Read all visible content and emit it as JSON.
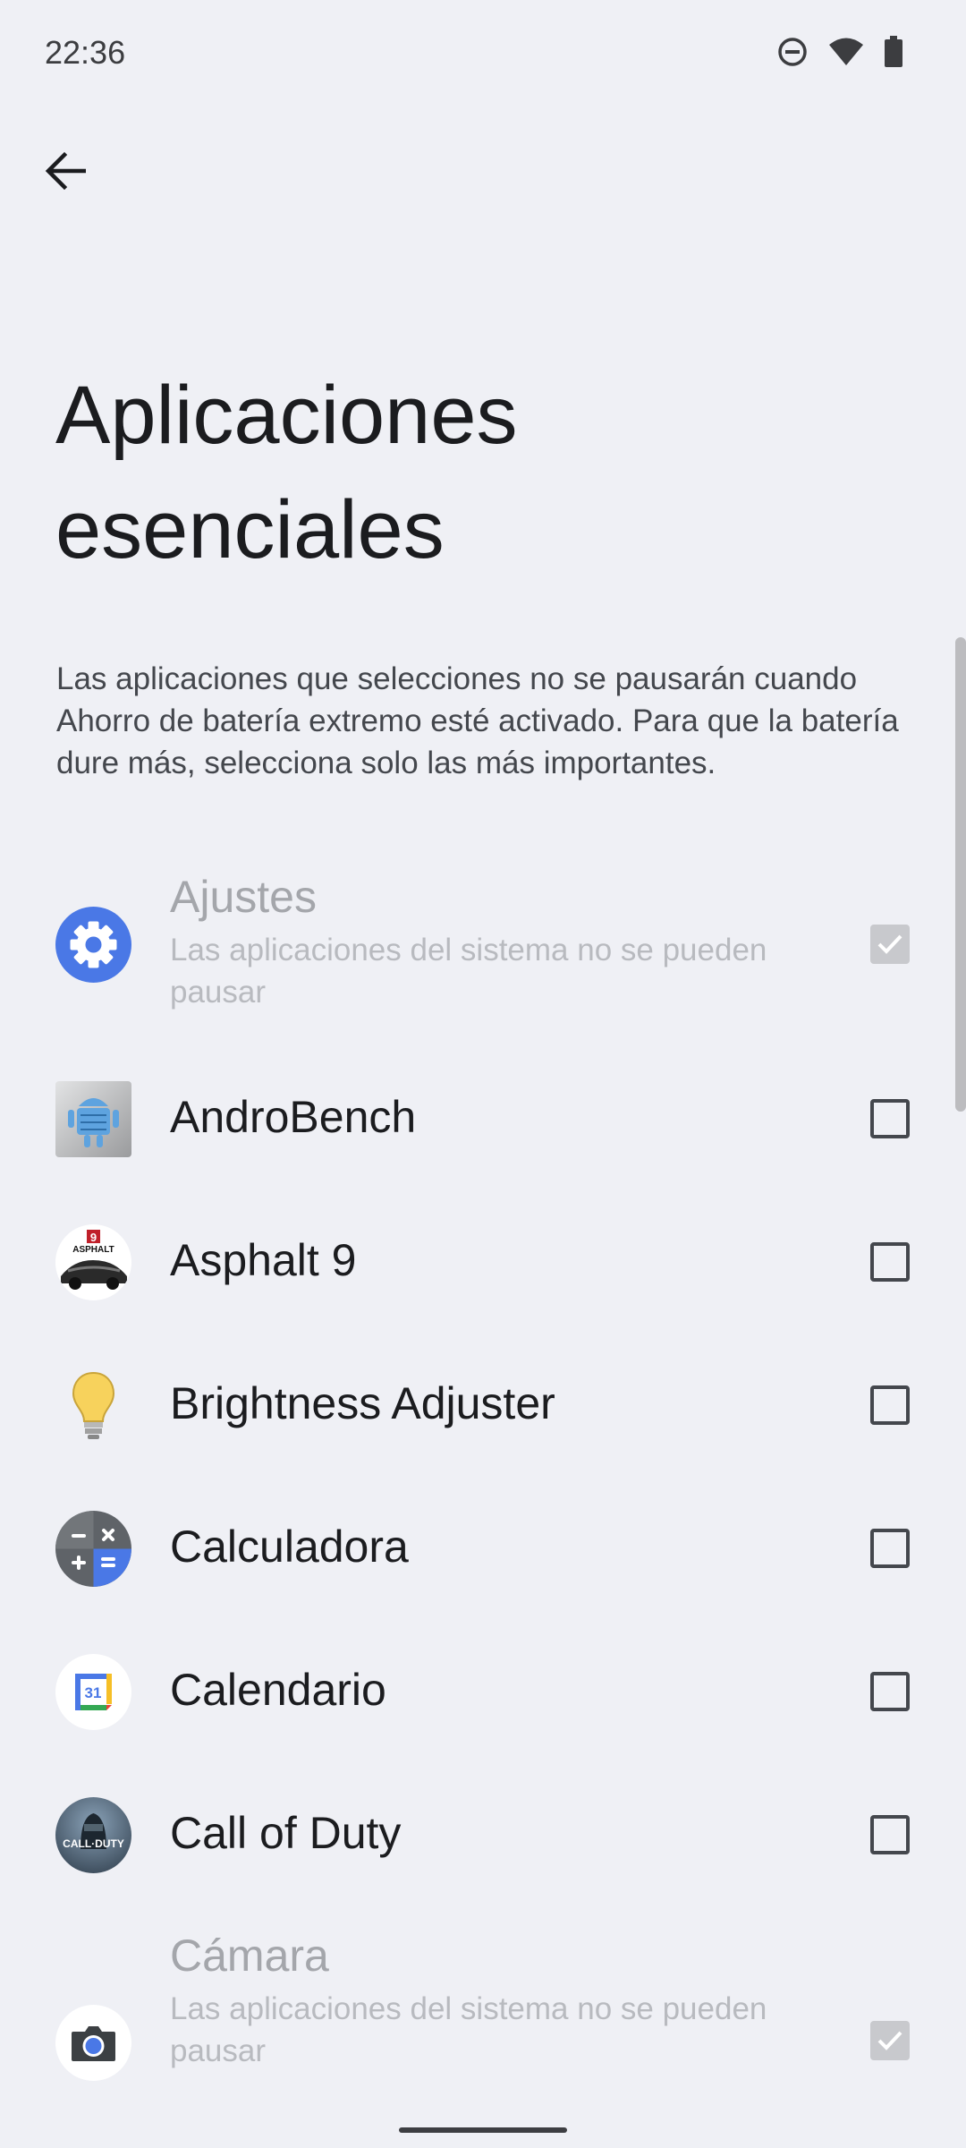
{
  "status_bar": {
    "time": "22:36",
    "icons": [
      "do-not-disturb-icon",
      "wifi-icon",
      "battery-icon"
    ]
  },
  "header": {
    "back_icon": "arrow-back-icon"
  },
  "title": "Aplicaciones esenciales",
  "description": "Las aplicaciones que selecciones no se pausarán cuando Ahorro de batería extremo esté activado. Para que la batería dure más, selecciona solo las más importantes.",
  "apps": [
    {
      "name": "Ajustes",
      "subtitle": "Las aplicaciones del sistema no se pueden pausar",
      "checked": true,
      "disabled": true,
      "icon": "settings-gear-icon"
    },
    {
      "name": "AndroBench",
      "subtitle": "",
      "checked": false,
      "disabled": false,
      "icon": "androbench-icon"
    },
    {
      "name": "Asphalt 9",
      "subtitle": "",
      "checked": false,
      "disabled": false,
      "icon": "asphalt-9-icon"
    },
    {
      "name": "Brightness Adjuster",
      "subtitle": "",
      "checked": false,
      "disabled": false,
      "icon": "lightbulb-icon"
    },
    {
      "name": "Calculadora",
      "subtitle": "",
      "checked": false,
      "disabled": false,
      "icon": "calculator-icon"
    },
    {
      "name": "Calendario",
      "subtitle": "",
      "checked": false,
      "disabled": false,
      "icon": "calendar-icon"
    },
    {
      "name": "Call of Duty",
      "subtitle": "",
      "checked": false,
      "disabled": false,
      "icon": "call-of-duty-icon"
    },
    {
      "name": "Cámara",
      "subtitle": "Las aplicaciones del sistema no se pueden pausar",
      "checked": true,
      "disabled": true,
      "icon": "camera-icon"
    }
  ],
  "calendar_icon_text": "31",
  "asphalt_icon_text": "ASPHALT",
  "cod_icon_text": "CALL·DUTY",
  "colors": {
    "background": "#eff0f5",
    "accent": "#4a78e6"
  }
}
